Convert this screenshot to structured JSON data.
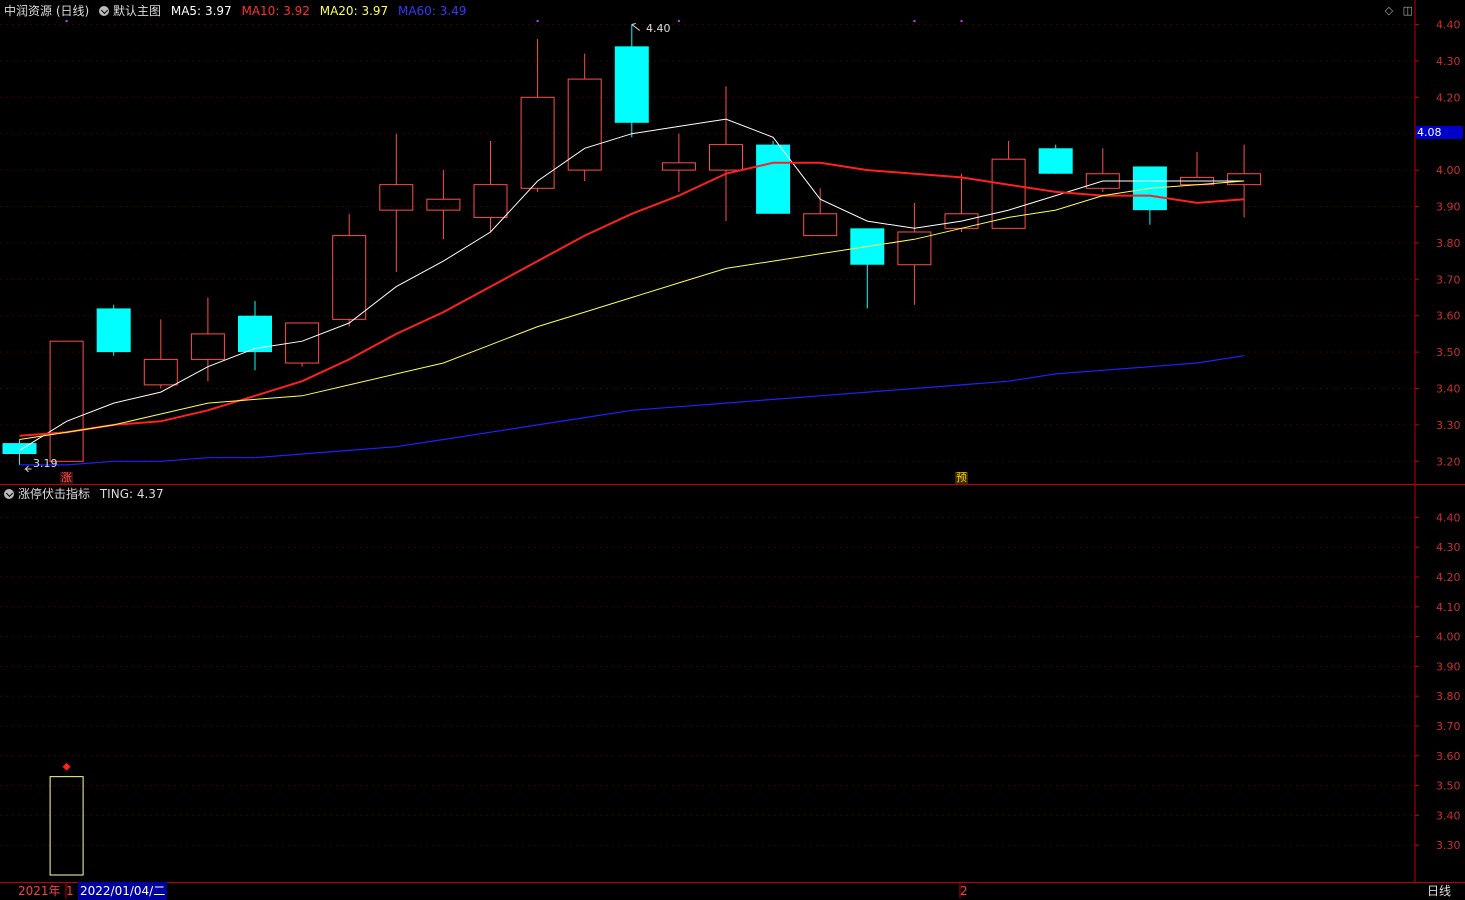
{
  "main_header": {
    "stock": "中润资源 (日线)",
    "template": "默认主图",
    "ma5_label": "MA5:",
    "ma5": "3.97",
    "ma10_label": "MA10:",
    "ma10": "3.92",
    "ma20_label": "MA20:",
    "ma20": "3.97",
    "ma60_label": "MA60:",
    "ma60": "3.49"
  },
  "sub_header": {
    "indicator": "涨停伏击指标",
    "ting_label": "TING:",
    "ting": "4.37"
  },
  "markers": {
    "high": "4.40",
    "low": "3.19",
    "zhang": "涨",
    "yu": "预",
    "current_price": "4.08"
  },
  "bottom_bar": {
    "year": "2021年",
    "m1": "1",
    "date": "2022/01/04/二",
    "m2": "2",
    "period": "日线"
  },
  "colors": {
    "up": "#ff4d4d",
    "down": "#00ffff",
    "ma5": "#ffffff",
    "ma10": "#ff2020",
    "ma20": "#ffff50",
    "ma60": "#2020ff",
    "axis": "#c00000"
  },
  "icons": [
    "circle-check-icon",
    "diamond-icon",
    "window-icon"
  ],
  "chart_data": [
    {
      "type": "candlestick",
      "ylim": [
        3.15,
        4.46
      ],
      "y_ticks": [
        "3.20",
        "3.30",
        "3.40",
        "3.50",
        "3.60",
        "3.70",
        "3.80",
        "3.90",
        "4.00",
        "4.10",
        "4.20",
        "4.30",
        "4.40"
      ],
      "candles": [
        {
          "o": 3.25,
          "h": 3.26,
          "l": 3.19,
          "c": 3.22
        },
        {
          "o": 3.2,
          "h": 3.53,
          "l": 3.2,
          "c": 3.53
        },
        {
          "o": 3.62,
          "h": 3.63,
          "l": 3.49,
          "c": 3.5
        },
        {
          "o": 3.41,
          "h": 3.59,
          "l": 3.4,
          "c": 3.48
        },
        {
          "o": 3.48,
          "h": 3.65,
          "l": 3.42,
          "c": 3.55
        },
        {
          "o": 3.6,
          "h": 3.64,
          "l": 3.45,
          "c": 3.5
        },
        {
          "o": 3.47,
          "h": 3.58,
          "l": 3.46,
          "c": 3.58
        },
        {
          "o": 3.59,
          "h": 3.88,
          "l": 3.57,
          "c": 3.82
        },
        {
          "o": 3.89,
          "h": 4.1,
          "l": 3.72,
          "c": 3.96
        },
        {
          "o": 3.89,
          "h": 4.0,
          "l": 3.81,
          "c": 3.92
        },
        {
          "o": 3.87,
          "h": 4.08,
          "l": 3.83,
          "c": 3.96
        },
        {
          "o": 3.95,
          "h": 4.36,
          "l": 3.94,
          "c": 4.2
        },
        {
          "o": 4.0,
          "h": 4.32,
          "l": 3.97,
          "c": 4.25
        },
        {
          "o": 4.34,
          "h": 4.4,
          "l": 4.09,
          "c": 4.13
        },
        {
          "o": 4.0,
          "h": 4.1,
          "l": 3.94,
          "c": 4.02
        },
        {
          "o": 4.0,
          "h": 4.23,
          "l": 3.86,
          "c": 4.07
        },
        {
          "o": 4.07,
          "h": 4.08,
          "l": 3.88,
          "c": 3.88
        },
        {
          "o": 3.82,
          "h": 3.95,
          "l": 3.82,
          "c": 3.88
        },
        {
          "o": 3.84,
          "h": 3.84,
          "l": 3.62,
          "c": 3.74
        },
        {
          "o": 3.74,
          "h": 3.91,
          "l": 3.63,
          "c": 3.83
        },
        {
          "o": 3.84,
          "h": 3.99,
          "l": 3.83,
          "c": 3.88
        },
        {
          "o": 3.84,
          "h": 4.08,
          "l": 3.84,
          "c": 4.03
        },
        {
          "o": 4.06,
          "h": 4.07,
          "l": 3.99,
          "c": 3.99
        },
        {
          "o": 3.95,
          "h": 4.06,
          "l": 3.94,
          "c": 3.99
        },
        {
          "o": 4.01,
          "h": 4.01,
          "l": 3.85,
          "c": 3.89
        },
        {
          "o": 3.96,
          "h": 4.05,
          "l": 3.96,
          "c": 3.98
        },
        {
          "o": 3.96,
          "h": 4.07,
          "l": 3.87,
          "c": 3.99
        }
      ],
      "series": [
        {
          "name": "MA5",
          "values": [
            3.23,
            3.31,
            3.36,
            3.39,
            3.46,
            3.51,
            3.53,
            3.58,
            3.68,
            3.75,
            3.83,
            3.97,
            4.06,
            4.1,
            4.12,
            4.14,
            4.09,
            3.92,
            3.86,
            3.84,
            3.86,
            3.89,
            3.93,
            3.97,
            3.97,
            3.97,
            3.97
          ]
        },
        {
          "name": "MA10",
          "values": [
            3.27,
            3.28,
            3.3,
            3.31,
            3.34,
            3.38,
            3.42,
            3.48,
            3.55,
            3.61,
            3.68,
            3.75,
            3.82,
            3.88,
            3.93,
            3.99,
            4.02,
            4.02,
            4.0,
            3.99,
            3.98,
            3.96,
            3.94,
            3.93,
            3.93,
            3.91,
            3.92
          ]
        },
        {
          "name": "MA20",
          "values": [
            3.26,
            3.28,
            3.3,
            3.33,
            3.36,
            3.37,
            3.38,
            3.41,
            3.44,
            3.47,
            3.52,
            3.57,
            3.61,
            3.65,
            3.69,
            3.73,
            3.75,
            3.77,
            3.79,
            3.81,
            3.84,
            3.87,
            3.89,
            3.93,
            3.95,
            3.96,
            3.97
          ]
        },
        {
          "name": "MA60",
          "values": [
            3.19,
            3.19,
            3.2,
            3.2,
            3.21,
            3.21,
            3.22,
            3.23,
            3.24,
            3.26,
            3.28,
            3.3,
            3.32,
            3.34,
            3.35,
            3.36,
            3.37,
            3.38,
            3.39,
            3.4,
            3.41,
            3.42,
            3.44,
            3.45,
            3.46,
            3.47,
            3.49
          ]
        }
      ]
    },
    {
      "type": "indicator",
      "ylim": [
        3.2,
        4.5
      ],
      "y_ticks": [
        "3.30",
        "3.40",
        "3.50",
        "3.60",
        "3.70",
        "3.80",
        "3.90",
        "4.00",
        "4.10",
        "4.20",
        "4.30",
        "4.40"
      ],
      "bars": [
        {
          "index": 1,
          "from": 3.2,
          "to": 3.53
        }
      ],
      "signal": {
        "index": 1,
        "value": 3.55
      }
    }
  ]
}
